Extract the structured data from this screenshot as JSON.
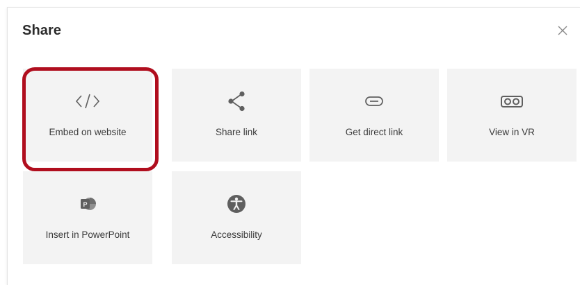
{
  "dialog": {
    "title": "Share",
    "close_icon": "close-icon"
  },
  "tiles": [
    {
      "label": "Embed on website",
      "icon": "code-icon",
      "highlighted": true
    },
    {
      "label": "Share link",
      "icon": "share-icon"
    },
    {
      "label": "Get direct link",
      "icon": "link-icon"
    },
    {
      "label": "View in VR",
      "icon": "vr-headset-icon"
    },
    {
      "label": "Insert in PowerPoint",
      "icon": "powerpoint-icon"
    },
    {
      "label": "Accessibility",
      "icon": "accessibility-icon"
    }
  ],
  "colors": {
    "highlight": "#b00e1e",
    "tile_background": "#f3f3f3",
    "icon": "#5f5f5f"
  }
}
